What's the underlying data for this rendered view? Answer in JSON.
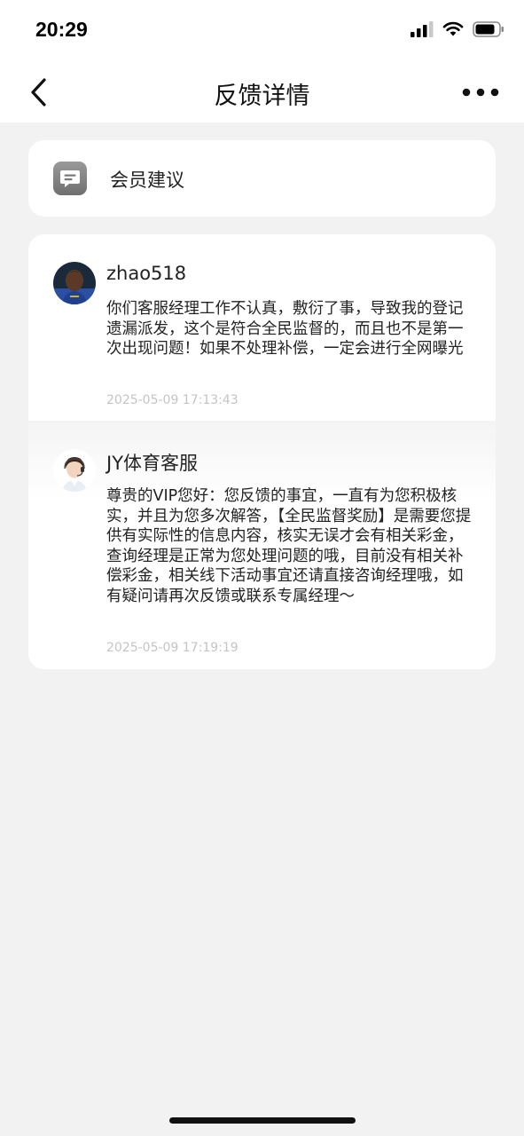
{
  "status_bar": {
    "time": "20:29"
  },
  "nav": {
    "title": "反馈详情"
  },
  "category": {
    "label": "会员建议",
    "icon": "message-icon"
  },
  "thread": [
    {
      "sender": "zhao518",
      "avatar": "user-avatar",
      "content": "你们客服经理工作不认真，敷衍了事，导致我的登记遗漏派发，这个是符合全民监督的，而且也不是第一次出现问题！如果不处理补偿，一定会进行全网曝光",
      "timestamp": "2025-05-09 17:13:43"
    },
    {
      "sender": "JY体育客服",
      "avatar": "service-agent-avatar",
      "content": "尊贵的VIP您好：您反馈的事宜，一直有为您积极核实，并且为您多次解答，【全民监督奖励】是需要您提供有实际性的信息内容，核实无误才会有相关彩金，查询经理是正常为您处理问题的哦，目前没有相关补偿彩金，相关线下活动事宜还请直接咨询经理哦，如有疑问请再次反馈或联系专属经理～",
      "timestamp": "2025-05-09 17:19:19"
    }
  ]
}
